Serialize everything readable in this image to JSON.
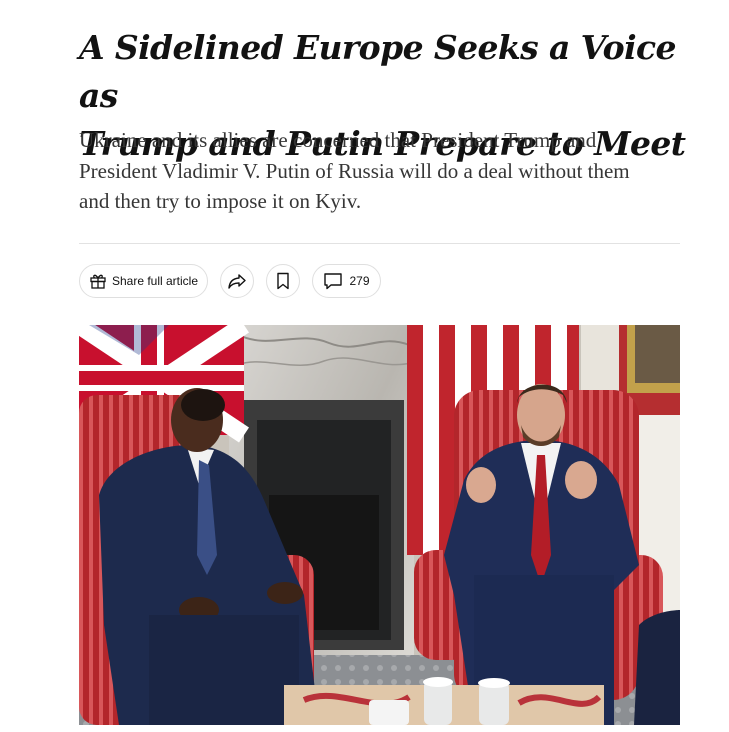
{
  "article": {
    "headline_line1": "A Sidelined Europe Seeks a Voice as",
    "headline_line2": "Trump and Putin Prepare to Meet",
    "dek_line1": "Ukraine and its allies are concerned that President Trump and",
    "dek_line2": "President Vladimir V. Putin of Russia will do a deal without them",
    "dek_line3": "and then try to impose it on Kyiv."
  },
  "toolbar": {
    "share_full_label": "Share full article",
    "comment_count": "279",
    "icons": {
      "gift": "gift-icon",
      "share": "share-arrow-icon",
      "save": "bookmark-icon",
      "comments": "comment-bubble-icon"
    }
  },
  "photo": {
    "subject": "two men seated in red striped armchairs in front of a fireplace with a Union Jack and a US flag"
  }
}
